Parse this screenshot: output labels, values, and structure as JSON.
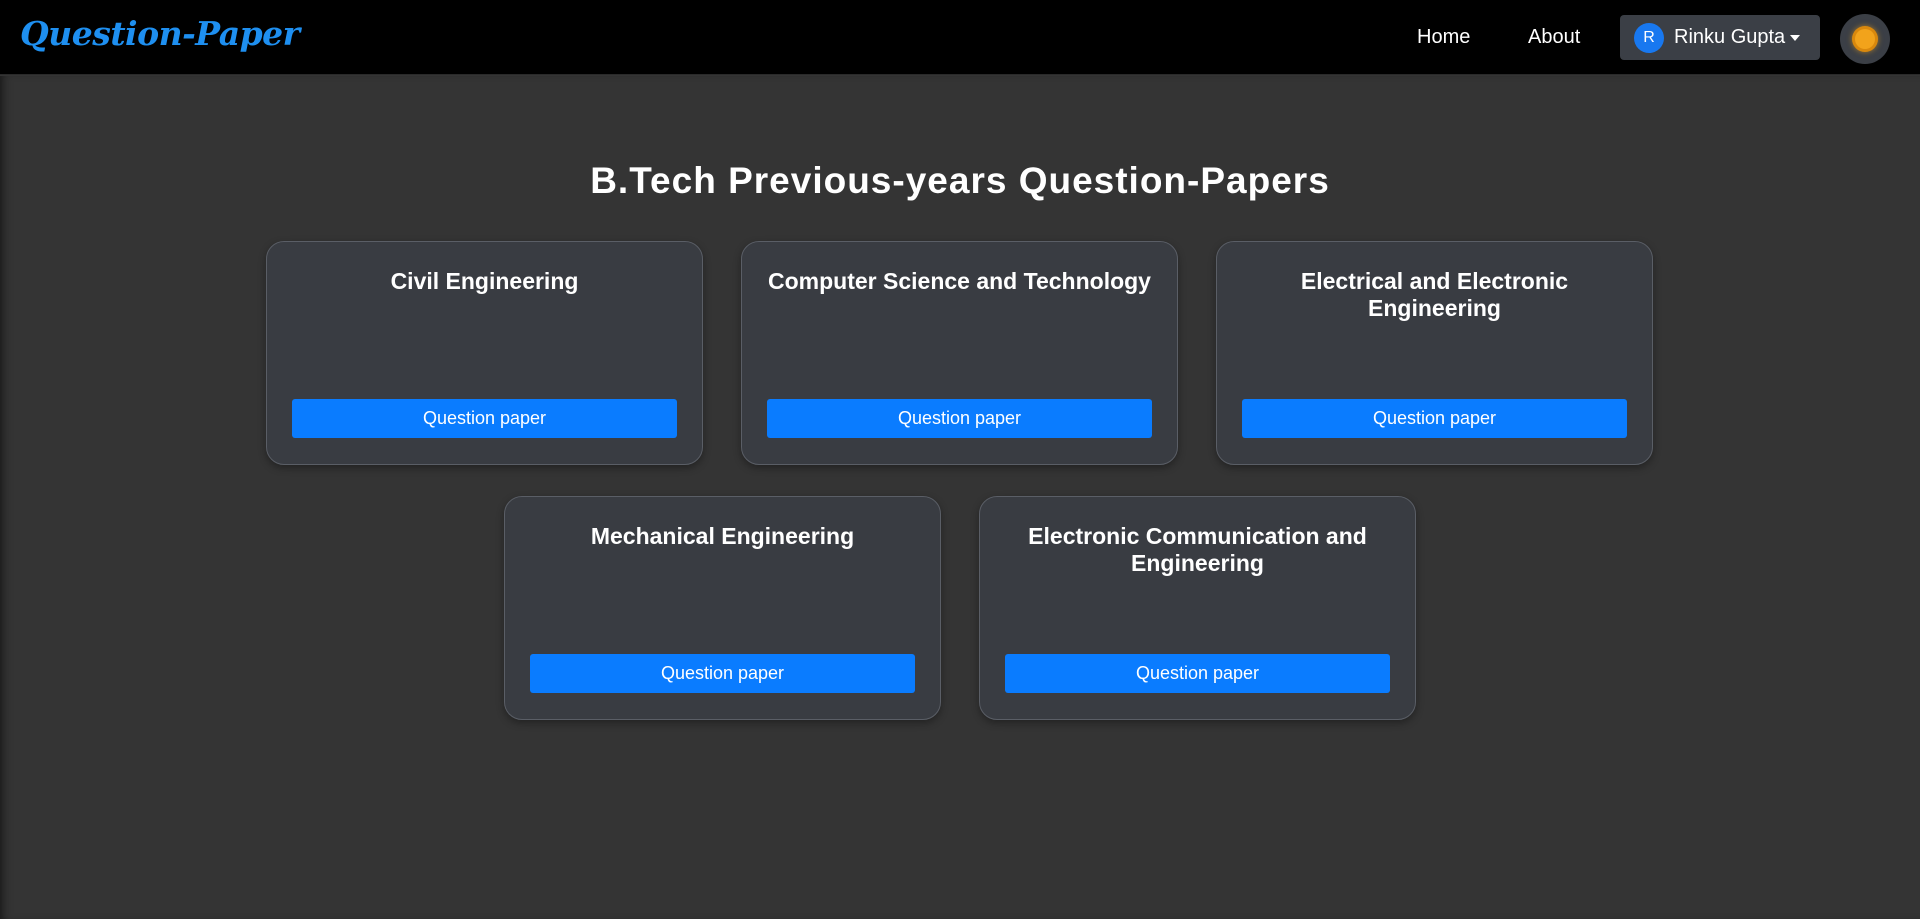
{
  "navbar": {
    "brand": "Question-Paper",
    "links": [
      {
        "label": "Home"
      },
      {
        "label": "About"
      }
    ],
    "user": {
      "avatar_initial": "R",
      "name": "Rinku Gupta"
    },
    "theme_toggle_icon": "sun-icon"
  },
  "main": {
    "title": "B.Tech Previous-years Question-Papers",
    "cards": [
      {
        "title": "Civil Engineering",
        "button_label": "Question paper"
      },
      {
        "title": "Computer Science and Technology",
        "button_label": "Question paper"
      },
      {
        "title": "Electrical and Electronic Engineering",
        "button_label": "Question paper"
      },
      {
        "title": "Mechanical Engineering",
        "button_label": "Question paper"
      },
      {
        "title": "Electronic Communication and Engineering",
        "button_label": "Question paper"
      }
    ]
  },
  "colors": {
    "brand": "#1e8ff0",
    "navbar_bg": "#000000",
    "page_bg": "#343434",
    "card_bg": "#393c42",
    "button": "#0a7cff"
  }
}
